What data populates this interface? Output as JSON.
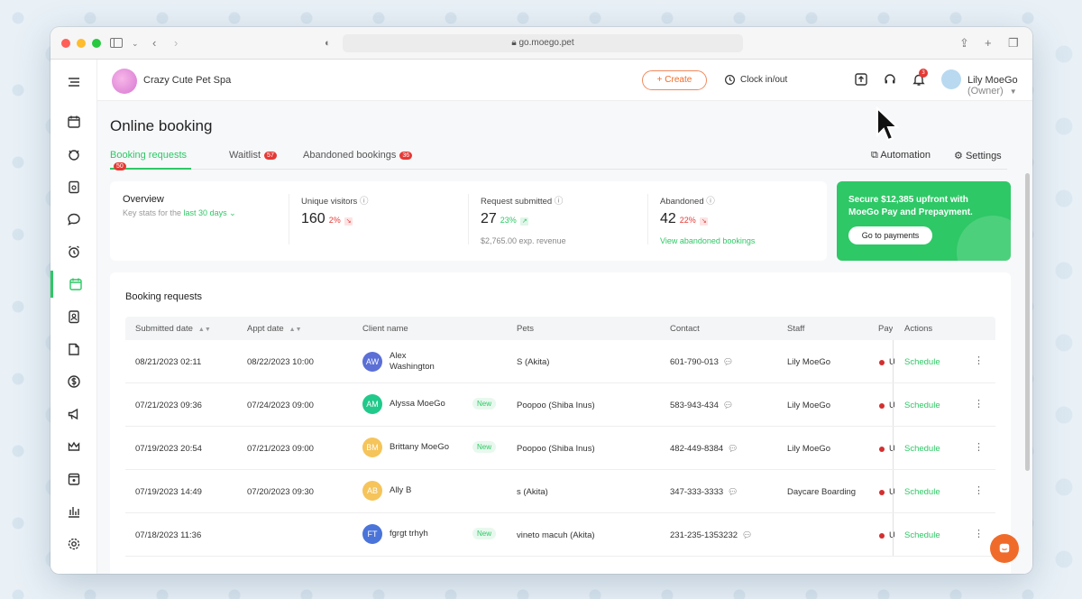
{
  "browser": {
    "url": "go.moego.pet"
  },
  "brand": {
    "name": "Crazy Cute Pet Spa"
  },
  "header": {
    "create_label": "+ Create",
    "clock_label": "Clock in/out",
    "notification_count": "3",
    "user_name": "Lily MoeGo",
    "user_role": "(Owner)"
  },
  "page": {
    "title": "Online booking"
  },
  "tabs": [
    {
      "label": "Booking requests",
      "count": "50",
      "active": true
    },
    {
      "label": "Waitlist",
      "count": "57",
      "active": false
    },
    {
      "label": "Abandoned bookings",
      "count": "36",
      "active": false
    }
  ],
  "actions": {
    "automation_label": "Automation",
    "settings_label": "Settings"
  },
  "overview": {
    "title": "Overview",
    "subtitle_prefix": "Key stats for the",
    "range": "last 30 days",
    "stats": [
      {
        "label": "Unique visitors",
        "value": "160",
        "change": "2%",
        "trend": "down",
        "foot": ""
      },
      {
        "label": "Request submitted",
        "value": "27",
        "change": "23%",
        "trend": "up",
        "foot": "$2,765.00 exp. revenue"
      },
      {
        "label": "Abandoned",
        "value": "42",
        "change": "22%",
        "trend": "down",
        "foot": "View abandoned bookings"
      }
    ]
  },
  "promo": {
    "text": "Secure $12,385 upfront with MoeGo Pay and Prepayment.",
    "button": "Go to payments"
  },
  "requests": {
    "title": "Booking requests",
    "columns": [
      "Submitted date",
      "Appt date",
      "Client name",
      "Pets",
      "Contact",
      "Staff",
      "Pay",
      "Actions"
    ],
    "rows": [
      {
        "submitted": "08/21/2023 02:11",
        "appt": "08/22/2023 10:00",
        "initials": "AW",
        "avatar_color": "#5b6fd6",
        "client": "Alex Washington",
        "new": "",
        "pets": "S (Akita)",
        "contact": "601-790-013",
        "staff": "Lily MoeGo",
        "pay": "U",
        "action": "Schedule"
      },
      {
        "submitted": "07/21/2023 09:36",
        "appt": "07/24/2023 09:00",
        "initials": "AM",
        "avatar_color": "#21c98b",
        "client": "Alyssa MoeGo",
        "new": "New",
        "pets": "Poopoo (Shiba Inus)",
        "contact": "583-943-434",
        "staff": "Lily MoeGo",
        "pay": "U",
        "action": "Schedule"
      },
      {
        "submitted": "07/19/2023 20:54",
        "appt": "07/21/2023 09:00",
        "initials": "BM",
        "avatar_color": "#f5c45a",
        "client": "Brittany MoeGo",
        "new": "New",
        "pets": "Poopoo (Shiba Inus)",
        "contact": "482-449-8384",
        "staff": "Lily MoeGo",
        "pay": "U",
        "action": "Schedule"
      },
      {
        "submitted": "07/19/2023 14:49",
        "appt": "07/20/2023 09:30",
        "initials": "AB",
        "avatar_color": "#f5c45a",
        "client": "Ally B",
        "new": "",
        "pets": "s (Akita)",
        "contact": "347-333-3333",
        "staff": "Daycare Boarding",
        "pay": "U",
        "action": "Schedule"
      },
      {
        "submitted": "07/18/2023 11:36",
        "appt": "",
        "initials": "FT",
        "avatar_color": "#4a74d9",
        "client": "fgrgt trhyh",
        "new": "New",
        "pets": "vineto macuh (Akita)",
        "contact": "231-235-1353232",
        "staff": "",
        "pay": "U",
        "action": "Schedule"
      }
    ]
  },
  "colors": {
    "accent": "#2ec866",
    "create": "#f06b2a",
    "badge": "#e53935"
  }
}
